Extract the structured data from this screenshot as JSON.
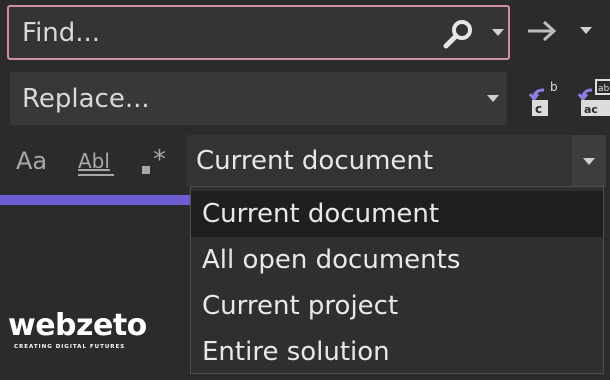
{
  "find": {
    "placeholder": "Find...",
    "search_icon": "search-icon",
    "options_icon": "chevron-down-icon",
    "next_icon": "arrow-right-icon",
    "more_icon": "chevron-down-icon"
  },
  "replace": {
    "placeholder": "Replace...",
    "next_icon": "replace-next-icon",
    "all_icon": "replace-all-icon"
  },
  "options": {
    "match_case_label": "Aa",
    "whole_word_label": "Abl",
    "regex_icon": "regex-icon"
  },
  "scope": {
    "selected": "Current document",
    "options": [
      "Current document",
      "All open documents",
      "Current project",
      "Entire solution"
    ]
  },
  "watermark": {
    "name": "webzeto",
    "tagline": "CREATING DIGITAL FUTURES"
  },
  "colors": {
    "accent": "#6c5ed1",
    "focus_border": "#cf8ea3",
    "icon_purple": "#8f7de0",
    "background": "#2b2a2c"
  }
}
